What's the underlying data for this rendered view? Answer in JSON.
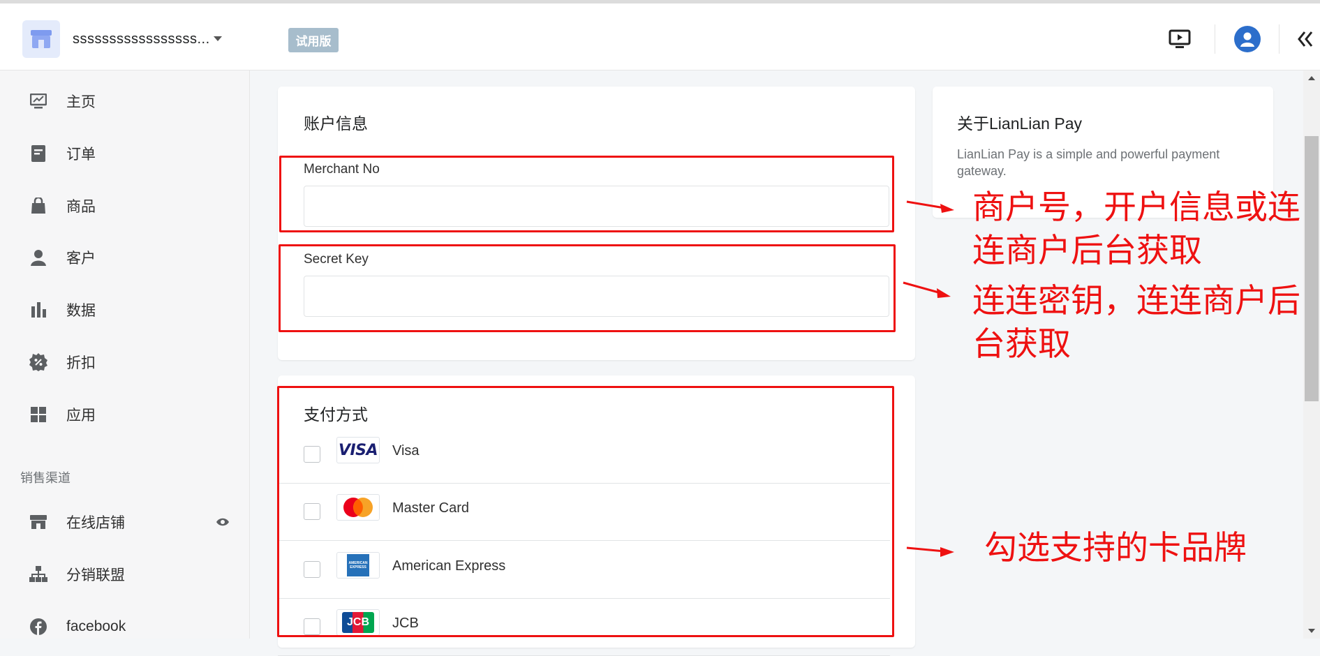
{
  "header": {
    "store_name": "sssssssssssssssss...",
    "trial_badge": "试用版"
  },
  "sidebar": {
    "items": [
      {
        "label": "主页",
        "icon": "chart-icon"
      },
      {
        "label": "订单",
        "icon": "order-icon"
      },
      {
        "label": "商品",
        "icon": "bag-icon"
      },
      {
        "label": "客户",
        "icon": "person-icon"
      },
      {
        "label": "数据",
        "icon": "bar-chart-icon"
      },
      {
        "label": "折扣",
        "icon": "discount-icon"
      },
      {
        "label": "应用",
        "icon": "apps-icon"
      }
    ],
    "section_label": "销售渠道",
    "channels": [
      {
        "label": "在线店铺",
        "icon": "store-icon"
      },
      {
        "label": "分销联盟",
        "icon": "network-icon"
      },
      {
        "label": "facebook",
        "icon": "facebook-icon"
      }
    ]
  },
  "account": {
    "title": "账户信息",
    "merchant_label": "Merchant No",
    "merchant_value": "",
    "secret_label": "Secret Key",
    "secret_value": ""
  },
  "payment": {
    "title": "支付方式",
    "methods": [
      {
        "name": "Visa",
        "logo_text": "VISA"
      },
      {
        "name": "Master Card"
      },
      {
        "name": "American Express",
        "logo_text": "AMERICAN EXPRESS"
      },
      {
        "name": "JCB",
        "logo_text": "JCB"
      }
    ]
  },
  "about": {
    "title": "关于LianLian Pay",
    "description": "LianLian Pay is a simple and powerful payment gateway."
  },
  "annotations": {
    "merchant_note": "商户号，开户信息或连连商户后台获取",
    "merchant_note_lines": [
      "商户号，开户信息或连",
      "连商户后台获取"
    ],
    "secret_note_lines": [
      "连连密钥，连连商户后",
      "台获取"
    ],
    "payment_note": "勾选支持的卡品牌"
  },
  "colors": {
    "annotation_red": "#ee1111",
    "badge": "#a7bdcc",
    "accent_blue": "#2c6ecb"
  }
}
